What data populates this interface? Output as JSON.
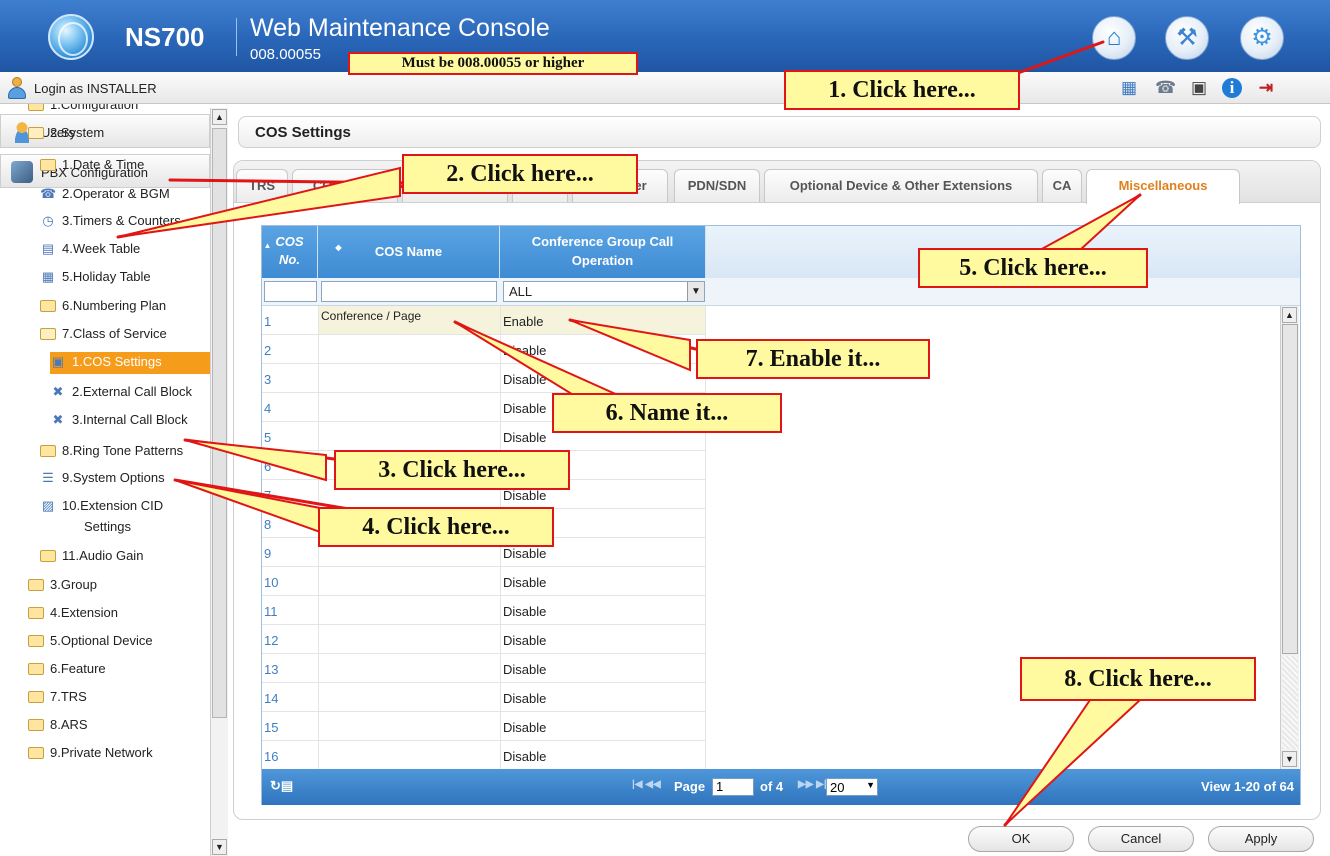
{
  "header": {
    "product": "NS700",
    "console_title": "Web Maintenance Console",
    "version": "008.00055",
    "icons": [
      "home-icon",
      "tools-icon",
      "settings-icon"
    ]
  },
  "login": {
    "text": "Login as INSTALLER",
    "toolbar_icons": [
      "calendar-icon",
      "phone-icon",
      "save-icon",
      "info-icon",
      "logout-icon"
    ]
  },
  "sidebar": {
    "users_label": "Users",
    "pbx_label": "PBX Configuration",
    "tree": [
      {
        "label": "1.Configuration",
        "icon": "folder-icon"
      },
      {
        "label": "2.System",
        "icon": "folder-open-icon"
      },
      {
        "label": "1.Date & Time",
        "icon": "folder-icon"
      },
      {
        "label": "2.Operator & BGM",
        "icon": "operator-icon"
      },
      {
        "label": "3.Timers & Counters",
        "icon": "clock-icon"
      },
      {
        "label": "4.Week Table",
        "icon": "week-table-icon"
      },
      {
        "label": "5.Holiday Table",
        "icon": "holiday-table-icon"
      },
      {
        "label": "6.Numbering Plan",
        "icon": "folder-icon"
      },
      {
        "label": "7.Class of Service",
        "icon": "folder-open-icon"
      },
      {
        "label": "1.COS Settings",
        "icon": "cos-icon"
      },
      {
        "label": "2.External Call Block",
        "icon": "call-block-icon"
      },
      {
        "label": "3.Internal Call Block",
        "icon": "call-block-icon"
      },
      {
        "label": "8.Ring Tone Patterns",
        "icon": "folder-icon"
      },
      {
        "label": "9.System Options",
        "icon": "options-icon"
      },
      {
        "label": "10.Extension CID",
        "icon": "extension-cid-icon"
      },
      {
        "label": "Settings",
        "icon": ""
      },
      {
        "label": "11.Audio Gain",
        "icon": "folder-icon"
      },
      {
        "label": "3.Group",
        "icon": "folder-icon"
      },
      {
        "label": "4.Extension",
        "icon": "folder-icon"
      },
      {
        "label": "5.Optional Device",
        "icon": "folder-icon"
      },
      {
        "label": "6.Feature",
        "icon": "folder-icon"
      },
      {
        "label": "7.TRS",
        "icon": "folder-icon"
      },
      {
        "label": "8.ARS",
        "icon": "folder-icon"
      },
      {
        "label": "9.Private Network",
        "icon": "folder-icon"
      }
    ]
  },
  "main": {
    "title": "COS Settings",
    "tabs": [
      "TRS",
      "CO & DND",
      "...",
      "...",
      "Manager",
      "PDN/SDN",
      "Optional Device & Other Extensions",
      "CA",
      "Miscellaneous"
    ],
    "active_tab": "Miscellaneous",
    "grid": {
      "col_no": "COS No.",
      "col_no_line1": "COS",
      "col_no_line2": "No.",
      "col_name": "COS Name",
      "col_op_line1": "Conference Group Call",
      "col_op_line2": "Operation",
      "filter_value": "ALL",
      "rows": [
        {
          "no": "1",
          "name": "Conference / Page",
          "op": "Enable"
        },
        {
          "no": "2",
          "name": "",
          "op": "Disable"
        },
        {
          "no": "3",
          "name": "",
          "op": "Disable"
        },
        {
          "no": "4",
          "name": "",
          "op": "Disable"
        },
        {
          "no": "5",
          "name": "",
          "op": "Disable"
        },
        {
          "no": "6",
          "name": "",
          "op": "Disable"
        },
        {
          "no": "7",
          "name": "",
          "op": "Disable"
        },
        {
          "no": "8",
          "name": "",
          "op": "Disable"
        },
        {
          "no": "9",
          "name": "",
          "op": "Disable"
        },
        {
          "no": "10",
          "name": "",
          "op": "Disable"
        },
        {
          "no": "11",
          "name": "",
          "op": "Disable"
        },
        {
          "no": "12",
          "name": "",
          "op": "Disable"
        },
        {
          "no": "13",
          "name": "",
          "op": "Disable"
        },
        {
          "no": "14",
          "name": "",
          "op": "Disable"
        },
        {
          "no": "15",
          "name": "",
          "op": "Disable"
        },
        {
          "no": "16",
          "name": "",
          "op": "Disable"
        }
      ]
    },
    "pager": {
      "page_label": "Page",
      "page_value": "1",
      "of_label": "of 4",
      "per_page": "20",
      "view_text": "View 1-20 of 64"
    },
    "buttons": {
      "ok": "OK",
      "cancel": "Cancel",
      "apply": "Apply"
    }
  },
  "annotations": {
    "version_note": "Must be 008.00055 or higher",
    "step1": "1. Click here...",
    "step2": "2. Click here...",
    "step3": "3. Click here...",
    "step4": "4. Click here...",
    "step5": "5. Click here...",
    "step6": "6. Name it...",
    "step7": "7. Enable it...",
    "step8": "8. Click here...",
    "callout_fill": "#fffaa0",
    "callout_border": "#e01616"
  },
  "colors": {
    "header_blue": "#2a66b8",
    "grid_header_blue": "#3f8bd3",
    "active_tab_orange": "#e0801e",
    "selected_tree": "#f59c1a"
  }
}
